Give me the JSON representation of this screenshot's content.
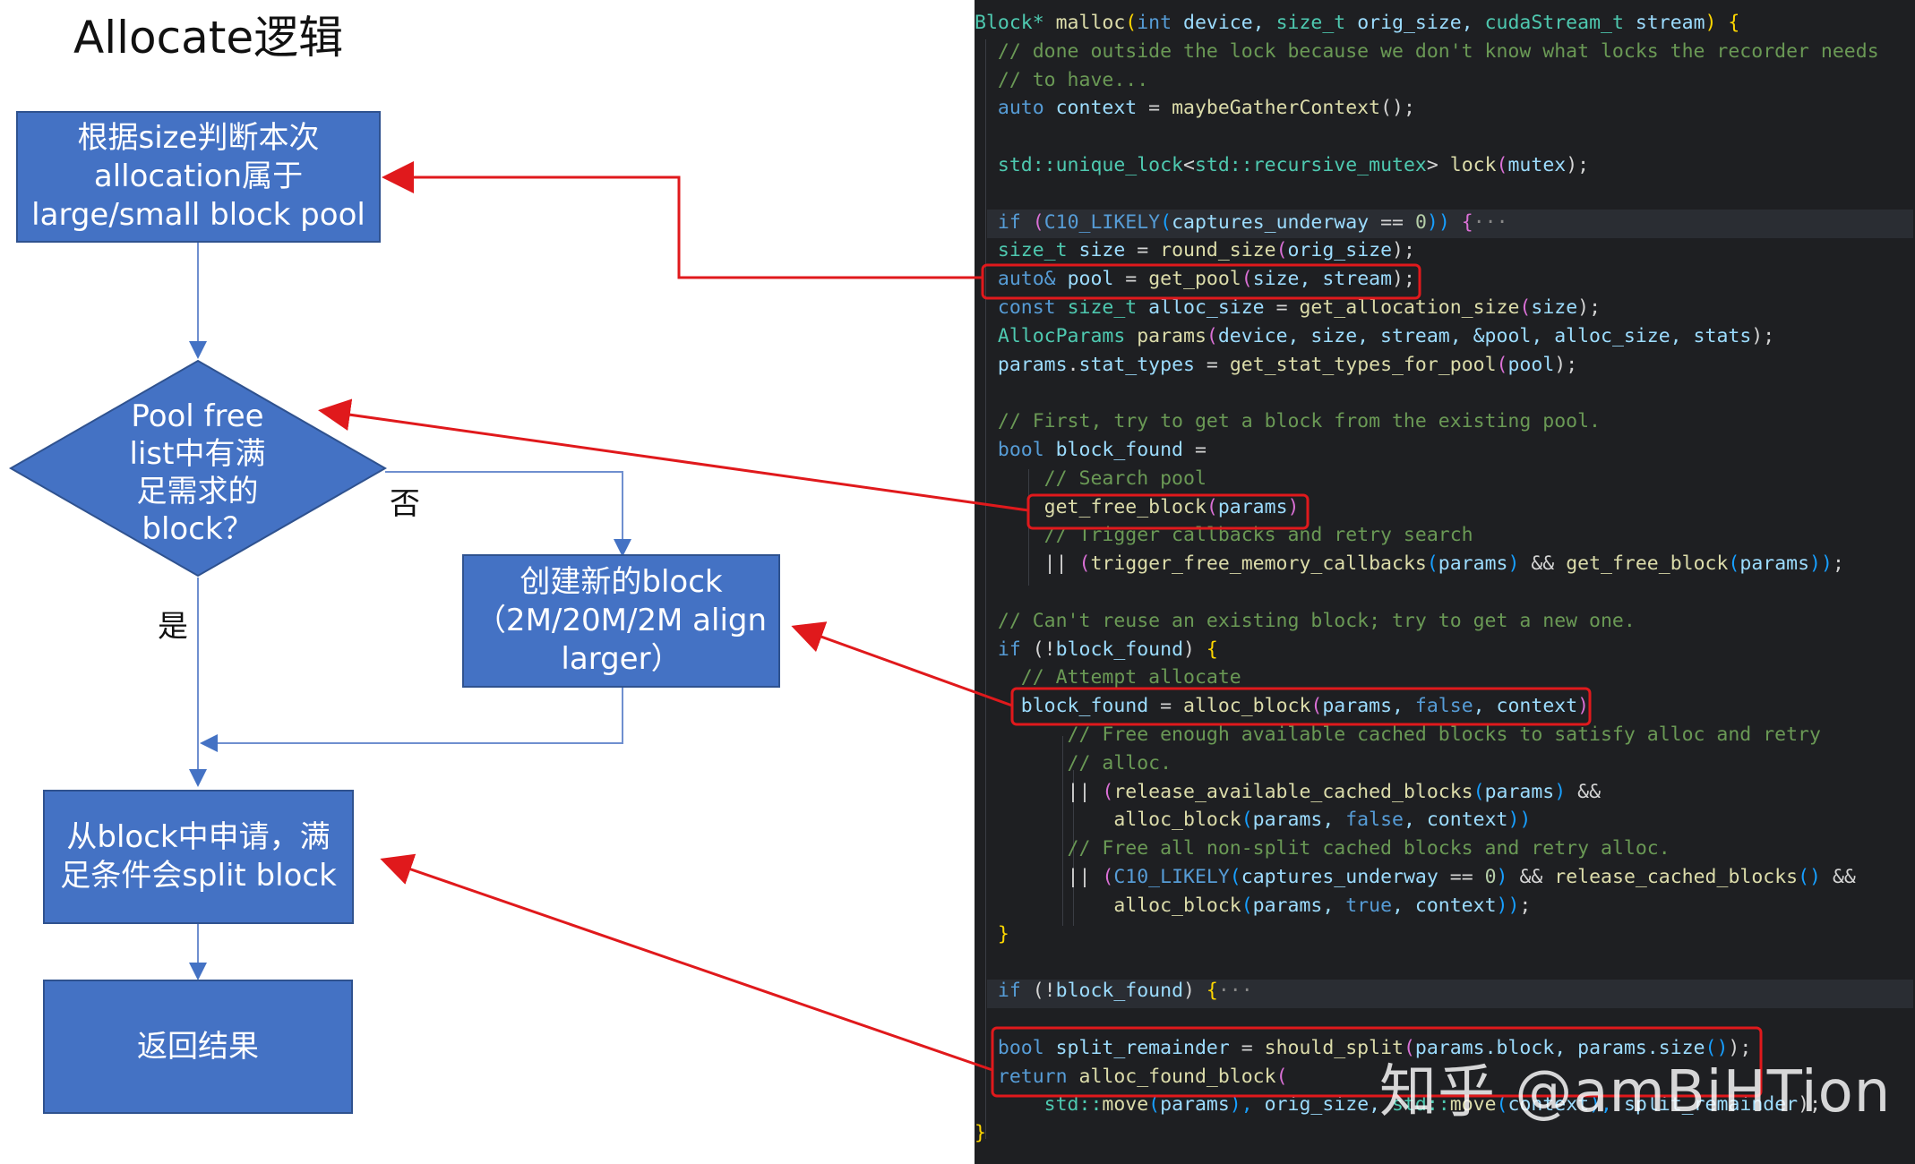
{
  "title": "Allocate逻辑",
  "flow": {
    "box1": "根据size判断本次\nallocation属于\nlarge/small block pool",
    "diamond": "Pool free\nlist中有满\n足需求的\nblock？",
    "box_new": "创建新的block\n（2M/20M/2M align\nlarger）",
    "box_split": "从block中申请，满\n足条件会split block",
    "box_return": "返回结果",
    "label_no": "否",
    "label_yes": "是"
  },
  "code_lines": [
    [
      [
        "Block* ",
        "ty"
      ],
      [
        "malloc",
        "fn"
      ],
      [
        "(",
        "br1"
      ],
      [
        "int ",
        "kw"
      ],
      [
        "device, ",
        "vr"
      ],
      [
        "size_t ",
        "ty"
      ],
      [
        "orig_size, ",
        "vr"
      ],
      [
        "cudaStream_t ",
        "ty"
      ],
      [
        "stream",
        "vr"
      ],
      [
        ") {",
        "br1"
      ]
    ],
    [
      [
        "  // done outside the lock because we don't know what locks the recorder needs",
        "cm"
      ]
    ],
    [
      [
        "  // to have...",
        "cm"
      ]
    ],
    [
      [
        "  auto ",
        "kw"
      ],
      [
        "context",
        "vr"
      ],
      [
        " = ",
        "pc"
      ],
      [
        "maybeGatherContext",
        "fn"
      ],
      [
        "();",
        "pc"
      ]
    ],
    [
      [
        "",
        "pc"
      ]
    ],
    [
      [
        "  std::",
        "ty"
      ],
      [
        "unique_lock",
        "ty"
      ],
      [
        "<",
        "pc"
      ],
      [
        "std::",
        "ty"
      ],
      [
        "recursive_mutex",
        "ty"
      ],
      [
        "> ",
        "pc"
      ],
      [
        "lock",
        "fn"
      ],
      [
        "(",
        "br2"
      ],
      [
        "mutex",
        "vr"
      ],
      [
        ");",
        "pc"
      ]
    ],
    [
      [
        "",
        "pc"
      ]
    ],
    [
      [
        "  if ",
        "kw"
      ],
      [
        "(",
        "br2"
      ],
      [
        "C10_LIKELY",
        "mc"
      ],
      [
        "(",
        "br3"
      ],
      [
        "captures_underway",
        "vr"
      ],
      [
        " == ",
        "pc"
      ],
      [
        "0",
        "nm"
      ],
      [
        ")) ",
        "br3"
      ],
      [
        "{",
        "br2"
      ],
      [
        "···",
        "fold"
      ]
    ],
    [
      [
        "  size_t ",
        "ty"
      ],
      [
        "size",
        "vr"
      ],
      [
        " = ",
        "pc"
      ],
      [
        "round_size",
        "fn"
      ],
      [
        "(",
        "br2"
      ],
      [
        "orig_size",
        "vr"
      ],
      [
        ");",
        "pc"
      ]
    ],
    [
      [
        "  auto& ",
        "kw"
      ],
      [
        "pool",
        "vr"
      ],
      [
        " = ",
        "pc"
      ],
      [
        "get_pool",
        "fn"
      ],
      [
        "(",
        "br2"
      ],
      [
        "size, stream",
        "vr"
      ],
      [
        ");",
        "pc"
      ]
    ],
    [
      [
        "  const ",
        "kw"
      ],
      [
        "size_t ",
        "ty"
      ],
      [
        "alloc_size",
        "vr"
      ],
      [
        " = ",
        "pc"
      ],
      [
        "get_allocation_size",
        "fn"
      ],
      [
        "(",
        "br2"
      ],
      [
        "size",
        "vr"
      ],
      [
        ");",
        "pc"
      ]
    ],
    [
      [
        "  AllocParams ",
        "ty"
      ],
      [
        "params",
        "fn"
      ],
      [
        "(",
        "br2"
      ],
      [
        "device, size, stream, &pool, alloc_size, stats",
        "vr"
      ],
      [
        ");",
        "pc"
      ]
    ],
    [
      [
        "  params",
        "vr"
      ],
      [
        ".",
        "pc"
      ],
      [
        "stat_types",
        "vr"
      ],
      [
        " = ",
        "pc"
      ],
      [
        "get_stat_types_for_pool",
        "fn"
      ],
      [
        "(",
        "br2"
      ],
      [
        "pool",
        "vr"
      ],
      [
        ");",
        "pc"
      ]
    ],
    [
      [
        "",
        "pc"
      ]
    ],
    [
      [
        "  // First, try to get a block from the existing pool.",
        "cm"
      ]
    ],
    [
      [
        "  bool ",
        "kw"
      ],
      [
        "block_found",
        "vr"
      ],
      [
        " =",
        "pc"
      ]
    ],
    [
      [
        "      // Search pool",
        "cm"
      ]
    ],
    [
      [
        "      get_free_block",
        "fn"
      ],
      [
        "(",
        "br2"
      ],
      [
        "params",
        "vr"
      ],
      [
        ")",
        "br2"
      ]
    ],
    [
      [
        "      // Trigger callbacks and retry search",
        "cm"
      ]
    ],
    [
      [
        "      || ",
        "pc"
      ],
      [
        "(",
        "br2"
      ],
      [
        "trigger_free_memory_callbacks",
        "fn"
      ],
      [
        "(",
        "br3"
      ],
      [
        "params",
        "vr"
      ],
      [
        ") ",
        "br3"
      ],
      [
        "&& ",
        "pc"
      ],
      [
        "get_free_block",
        "fn"
      ],
      [
        "(",
        "br3"
      ],
      [
        "params",
        "vr"
      ],
      [
        "))",
        "br3"
      ],
      [
        ";",
        "pc"
      ]
    ],
    [
      [
        "",
        "pc"
      ]
    ],
    [
      [
        "  // Can't reuse an existing block; try to get a new one.",
        "cm"
      ]
    ],
    [
      [
        "  if ",
        "kw"
      ],
      [
        "(!",
        "pc"
      ],
      [
        "block_found",
        "vr"
      ],
      [
        ") ",
        "pc"
      ],
      [
        "{",
        "br1"
      ]
    ],
    [
      [
        "    // Attempt allocate",
        "cm"
      ]
    ],
    [
      [
        "    block_found",
        "vr"
      ],
      [
        " = ",
        "pc"
      ],
      [
        "alloc_block",
        "fn"
      ],
      [
        "(",
        "br2"
      ],
      [
        "params, ",
        "vr"
      ],
      [
        "false",
        "kw"
      ],
      [
        ", context",
        "vr"
      ],
      [
        ")",
        "br2"
      ]
    ],
    [
      [
        "        // Free enough available cached blocks to satisfy alloc and retry",
        "cm"
      ]
    ],
    [
      [
        "        // alloc.",
        "cm"
      ]
    ],
    [
      [
        "        || ",
        "pc"
      ],
      [
        "(",
        "br2"
      ],
      [
        "release_available_cached_blocks",
        "fn"
      ],
      [
        "(",
        "br3"
      ],
      [
        "params",
        "vr"
      ],
      [
        ") ",
        "br3"
      ],
      [
        "&&",
        "pc"
      ]
    ],
    [
      [
        "            alloc_block",
        "fn"
      ],
      [
        "(",
        "br3"
      ],
      [
        "params, ",
        "vr"
      ],
      [
        "false",
        "kw"
      ],
      [
        ", context",
        "vr"
      ],
      [
        "))",
        "br3"
      ]
    ],
    [
      [
        "        // Free all non-split cached blocks and retry alloc.",
        "cm"
      ]
    ],
    [
      [
        "        || ",
        "pc"
      ],
      [
        "(",
        "br2"
      ],
      [
        "C10_LIKELY",
        "mc"
      ],
      [
        "(",
        "br3"
      ],
      [
        "captures_underway",
        "vr"
      ],
      [
        " == ",
        "pc"
      ],
      [
        "0",
        "nm"
      ],
      [
        ") ",
        "br3"
      ],
      [
        "&& ",
        "pc"
      ],
      [
        "release_cached_blocks",
        "fn"
      ],
      [
        "() ",
        "br3"
      ],
      [
        "&&",
        "pc"
      ]
    ],
    [
      [
        "            alloc_block",
        "fn"
      ],
      [
        "(",
        "br3"
      ],
      [
        "params, ",
        "vr"
      ],
      [
        "true",
        "kw"
      ],
      [
        ", context",
        "vr"
      ],
      [
        "))",
        "br3"
      ],
      [
        ";",
        "pc"
      ]
    ],
    [
      [
        "  }",
        "br1"
      ]
    ],
    [
      [
        "",
        "pc"
      ]
    ],
    [
      [
        "  if ",
        "kw"
      ],
      [
        "(!",
        "pc"
      ],
      [
        "block_found",
        "vr"
      ],
      [
        ") ",
        "pc"
      ],
      [
        "{",
        "br1"
      ],
      [
        "···",
        "fold"
      ]
    ],
    [
      [
        "",
        "pc"
      ]
    ],
    [
      [
        "  bool ",
        "kw"
      ],
      [
        "split_remainder",
        "vr"
      ],
      [
        " = ",
        "pc"
      ],
      [
        "should_split",
        "fn"
      ],
      [
        "(",
        "br2"
      ],
      [
        "params.block, params.size",
        "vr"
      ],
      [
        "()",
        "br3"
      ],
      [
        ");",
        "pc"
      ]
    ],
    [
      [
        "  return ",
        "kw"
      ],
      [
        "alloc_found_block",
        "fn"
      ],
      [
        "(",
        "br2"
      ]
    ],
    [
      [
        "      std::",
        "ty"
      ],
      [
        "move",
        "fn"
      ],
      [
        "(",
        "br3"
      ],
      [
        "params",
        "vr"
      ],
      [
        "), ",
        "br3"
      ],
      [
        "orig_size, ",
        "vr"
      ],
      [
        "std::",
        "ty"
      ],
      [
        "move",
        "fn"
      ],
      [
        "(",
        "br3"
      ],
      [
        "context",
        "vr"
      ],
      [
        "), ",
        "br3"
      ],
      [
        "split_remainder",
        "vr"
      ],
      [
        ");",
        "pc"
      ]
    ],
    [
      [
        "}",
        "br1"
      ]
    ]
  ],
  "watermark": "知乎 @amBiHTion",
  "colors": {
    "box_fill": "#4472c4",
    "highlight_red": "#e0191c",
    "connector": "#6f8fcf",
    "code_bg": "#1e1f22"
  }
}
